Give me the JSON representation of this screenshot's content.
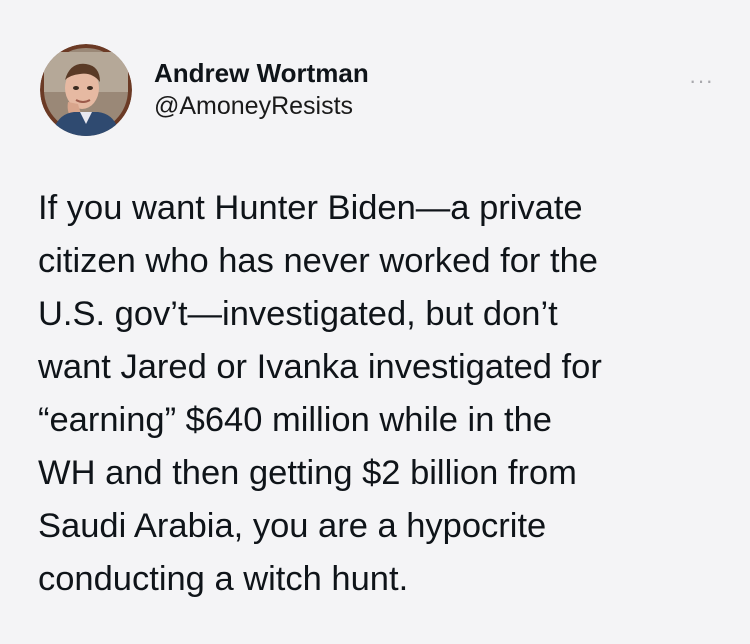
{
  "tweet": {
    "author": {
      "display_name": "Andrew Wortman",
      "handle": "@AmoneyResists",
      "avatar": "user-avatar-photo"
    },
    "more_options_icon": "more-horizontal-icon",
    "more_options_glyph": "···",
    "text_lines": [
      "If you want Hunter Biden—a private",
      "citizen who has never worked for the",
      "U.S. gov’t—investigated, but don’t",
      "want Jared or Ivanka investigated for",
      "“earning” $640 million while in the",
      "WH and then getting $2 billion from",
      "Saudi Arabia, you are a hypocrite",
      "conducting a witch hunt."
    ]
  },
  "colors": {
    "background": "#f4f4f6",
    "text": "#0f1419",
    "avatar_ring": "#6b3a25",
    "more_icon": "#a8a8ad"
  }
}
